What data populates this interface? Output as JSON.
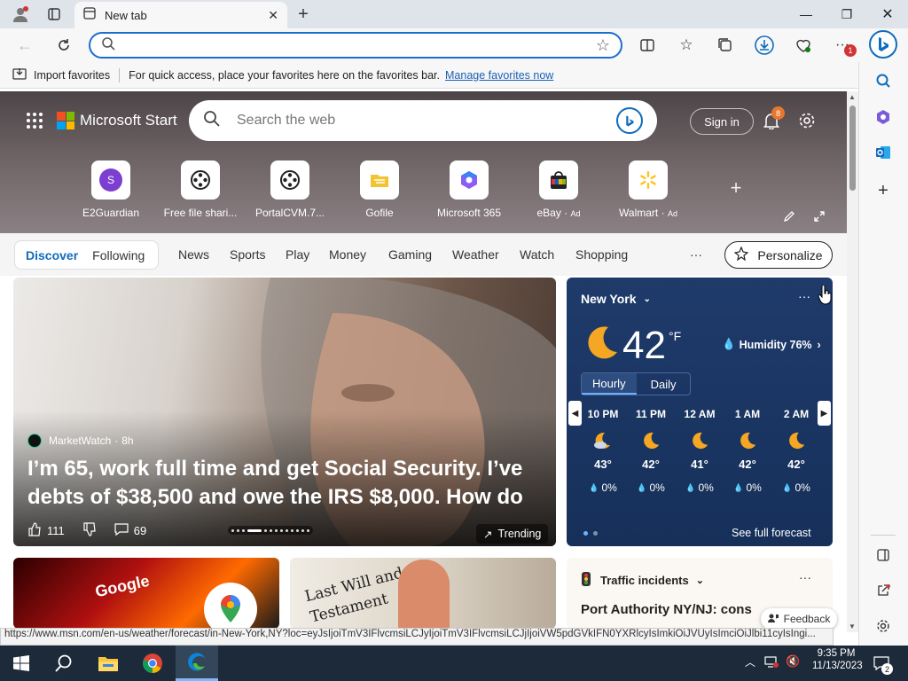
{
  "tab": {
    "title": "New tab"
  },
  "address": {
    "placeholder": ""
  },
  "favbar": {
    "import_label": "Import favorites",
    "message": "For quick access, place your favorites here on the favorites bar.",
    "manage_link": "Manage favorites now"
  },
  "toolbar": {
    "notification_count": "1"
  },
  "header": {
    "brand": "Microsoft Start",
    "search_placeholder": "Search the web",
    "signin_label": "Sign in",
    "notification_count": "8"
  },
  "quicklinks": [
    {
      "label": "E2Guardian",
      "icon": "letter-s-icon",
      "letter": "S"
    },
    {
      "label": "Free file shari...",
      "icon": "film-reel-icon"
    },
    {
      "label": "PortalCVM.7...",
      "icon": "film-reel-icon"
    },
    {
      "label": "Gofile",
      "icon": "gofile-icon"
    },
    {
      "label": "Microsoft 365",
      "icon": "m365-icon"
    },
    {
      "label": "eBay",
      "icon": "shopping-bag-icon",
      "ad": "Ad"
    },
    {
      "label": "Walmart",
      "icon": "walmart-spark-icon",
      "ad": "Ad"
    }
  ],
  "nav": {
    "discover": "Discover",
    "following": "Following",
    "items": [
      "News",
      "Sports",
      "Play",
      "Money",
      "Gaming",
      "Weather",
      "Watch",
      "Shopping"
    ],
    "more": "···",
    "personalize": "Personalize"
  },
  "main_card": {
    "source": "MarketWatch",
    "age": "8h",
    "headline": "I’m 65, work full time and get Social Security. I’ve debts of $38,500 and owe the IRS $8,000. How do I...",
    "likes": "111",
    "comments": "69",
    "trending": "Trending"
  },
  "weather": {
    "city": "New York",
    "temp": "42",
    "unit": "°F",
    "humidity": "Humidity 76%",
    "tabs": [
      "Hourly",
      "Daily"
    ],
    "hours": [
      {
        "time": "10 PM",
        "temp": "43°",
        "precip": "0%",
        "icon": "partly-cloudy-night-icon"
      },
      {
        "time": "11 PM",
        "temp": "42°",
        "precip": "0%",
        "icon": "moon-icon"
      },
      {
        "time": "12 AM",
        "temp": "41°",
        "precip": "0%",
        "icon": "moon-icon"
      },
      {
        "time": "1 AM",
        "temp": "42°",
        "precip": "0%",
        "icon": "moon-icon"
      },
      {
        "time": "2 AM",
        "temp": "42°",
        "precip": "0%",
        "icon": "moon-icon"
      }
    ],
    "forecast_link": "See full forecast"
  },
  "bottom_cards": [
    {
      "label": "Google",
      "icon": "google-maps-icon"
    },
    {
      "label": "Last Will and Testament"
    }
  ],
  "traffic": {
    "title": "Traffic incidents",
    "text": "Port Authority NY/NJ: cons"
  },
  "feedback": "Feedback",
  "status_url": "https://www.msn.com/en-us/weather/forecast/in-New-York,NY?loc=eyJsIjoiTmV3IFlvcmsiLCJyIjoiTmV3IFlvcmsiLCJjIjoiVW5pdGVkIFN0YXRlcyIsImkiOiJVUyIsImciOiJlbi11cyIsIngi...",
  "clock": {
    "time": "9:35 PM",
    "date": "11/13/2023"
  },
  "taskbar_notif": "2",
  "colors": {
    "accent": "#0f6cbd",
    "edge_blue": "#1a6ecf",
    "taskbar": "#1c2a3a",
    "weather_bg": "#1f3b6b"
  }
}
